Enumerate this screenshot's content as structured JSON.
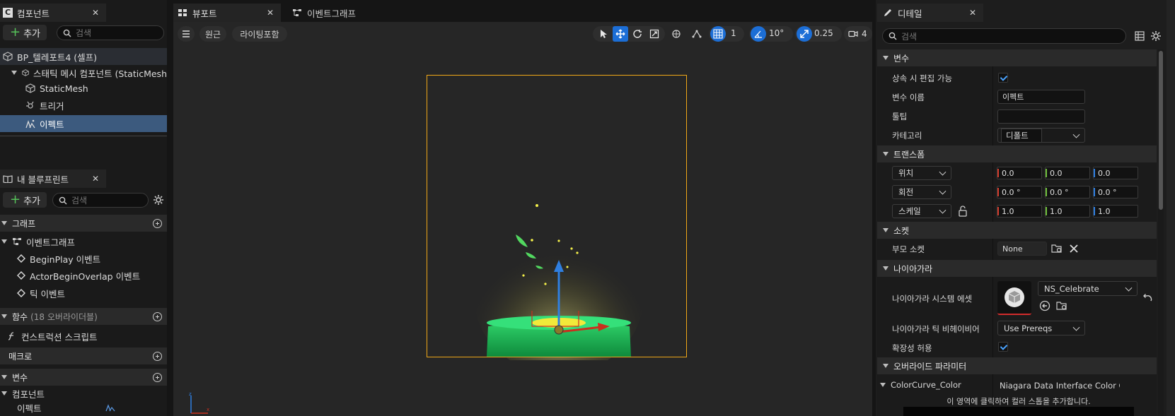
{
  "components_panel": {
    "tab_title": "컴포넌트",
    "add_label": "추가",
    "search_placeholder": "검색",
    "tree": [
      {
        "label": "BP_텔레포트4 (셀프)"
      },
      {
        "label": "스태틱 메시 컴포넌트 (StaticMesh"
      },
      {
        "label": "StaticMesh"
      },
      {
        "label": "트리거"
      },
      {
        "label": "이펙트"
      }
    ]
  },
  "blueprint_panel": {
    "tab_title": "내 블루프린트",
    "add_label": "추가",
    "search_placeholder": "검색",
    "graph_section": "그래프",
    "event_graph": "이벤트그래프",
    "events": [
      "BeginPlay 이벤트",
      "ActorBeginOverlap 이벤트",
      "틱 이벤트"
    ],
    "functions_section": "함수",
    "functions_count": "(18 오버라이더블)",
    "construction_script": "컨스트럭션 스크립트",
    "macros_section": "매크로",
    "variables_section": "변수",
    "components_subsection": "컴포넌트",
    "component_var": "이펙트"
  },
  "viewport": {
    "tab_viewport": "뷰포트",
    "tab_event_graph": "이벤트그래프",
    "perspective_label": "원근",
    "lighting_label": "라이팅포함",
    "grid_snap": "1",
    "rotation_snap": "10°",
    "scale_snap": "0.25",
    "camera_speed": "4"
  },
  "details": {
    "tab_title": "디테일",
    "search_placeholder": "검색",
    "sections": {
      "variable": "변수",
      "transform": "트랜스폼",
      "socket": "소켓",
      "niagara": "나이아가라",
      "override": "오버라이드 파라미터"
    },
    "labels": {
      "instance_editable": "상속 시 편집 가능",
      "variable_name": "변수 이름",
      "tooltip": "툴팁",
      "category": "카테고리",
      "parent_socket": "부모 소켓",
      "niagara_system_asset": "나이아가라 시스템 에셋",
      "niagara_tick_behavior": "나이아가라 틱 비헤이비어",
      "allow_scalability": "확장성 허용",
      "color_curve": "ColorCurve_Color"
    },
    "values": {
      "variable_name": "이펙트",
      "tooltip": "",
      "category": "디폴트",
      "location_mode": "위치",
      "rotation_mode": "회전",
      "scale_mode": "스케일",
      "location": [
        "0.0",
        "0.0",
        "0.0"
      ],
      "rotation": [
        "0.0 °",
        "0.0 °",
        "0.0 °"
      ],
      "scale": [
        "1.0",
        "1.0",
        "1.0"
      ],
      "parent_socket": "None",
      "niagara_asset": "NS_Celebrate",
      "tick_behavior": "Use Prereqs",
      "color_curve": "Niagara Data Interface Color Curv",
      "color_curve_hint": "이 영역에 클릭하여 컬러 스톱을 추가합니다."
    }
  }
}
